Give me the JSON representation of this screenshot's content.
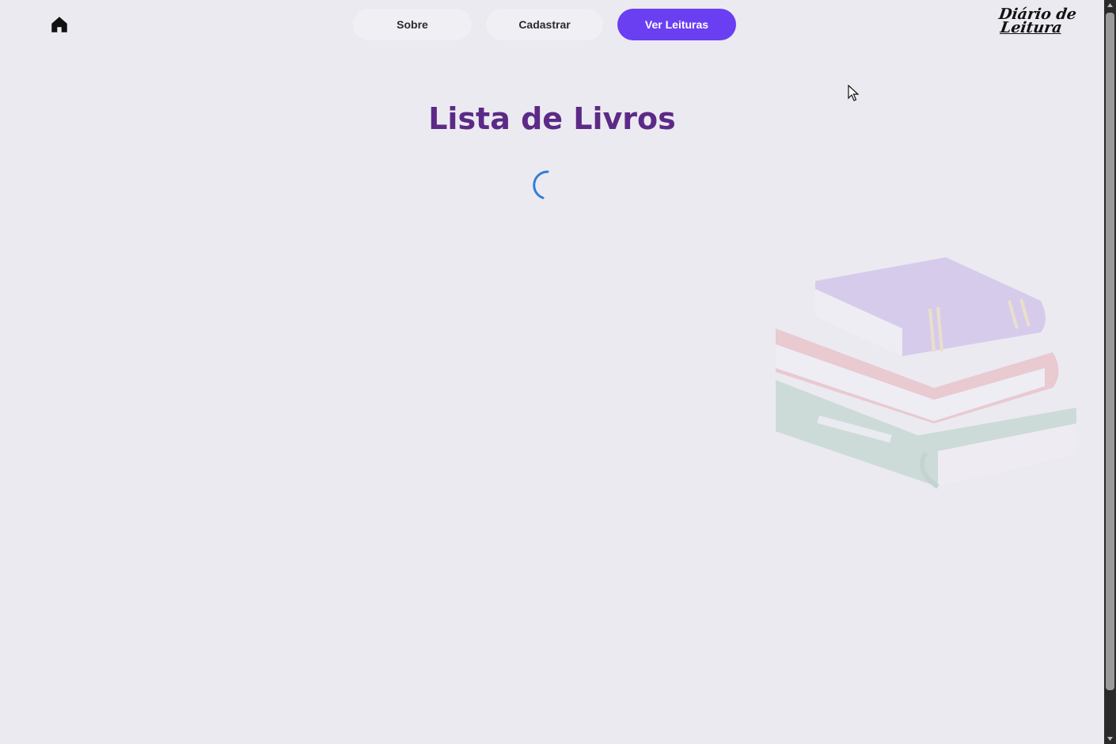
{
  "nav": {
    "home_icon": "home-icon",
    "items": [
      {
        "label": "Sobre"
      },
      {
        "label": "Cadastrar"
      },
      {
        "label": "Ver Leituras"
      }
    ],
    "active_index": 2
  },
  "logo": {
    "line1": "Diário de",
    "line2": "Leitura"
  },
  "main": {
    "title": "Lista de Livros",
    "loading": true
  },
  "colors": {
    "accent": "#6a3ff2",
    "title": "#5c2a86",
    "background": "#eceaf1",
    "spinner": "#2f7fd8"
  }
}
